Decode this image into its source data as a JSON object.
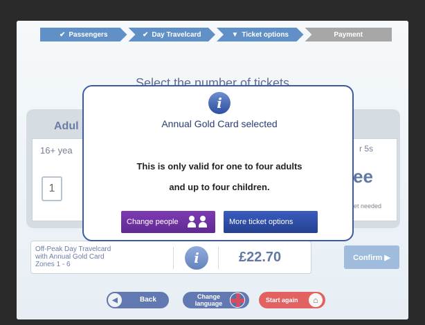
{
  "progress": {
    "steps": [
      {
        "label": "Passengers",
        "done": true
      },
      {
        "label": "Day Travelcard",
        "done": true
      },
      {
        "label": "Ticket options",
        "current": true
      },
      {
        "label": "Payment",
        "done": false
      }
    ]
  },
  "background": {
    "title": "Select the number of tickets",
    "adults_heading": "Adul",
    "adults_age": "16+ yea",
    "adults_qty": "1",
    "under5_age": "r 5s",
    "under5_price": "ee",
    "under5_note": "et needed"
  },
  "summary": {
    "line1": "Off-Peak Day Travelcard",
    "line2": "with Annual Gold Card",
    "line3": "Zones 1 - 6",
    "price": "£22.70",
    "confirm_label": "Confirm ▶"
  },
  "bottom": {
    "back_label": "Back",
    "language_label": "Change language",
    "start_again_label": "Start again"
  },
  "modal": {
    "title": "Annual Gold Card selected",
    "line1": "This is only valid for one to four adults",
    "line2": "and up to four children.",
    "change_people_label": "Change people",
    "more_options_label": "More ticket options"
  },
  "colors": {
    "brand_blue": "#2c6bb3",
    "purple": "#6a2f9e",
    "red": "#d92e2e"
  }
}
